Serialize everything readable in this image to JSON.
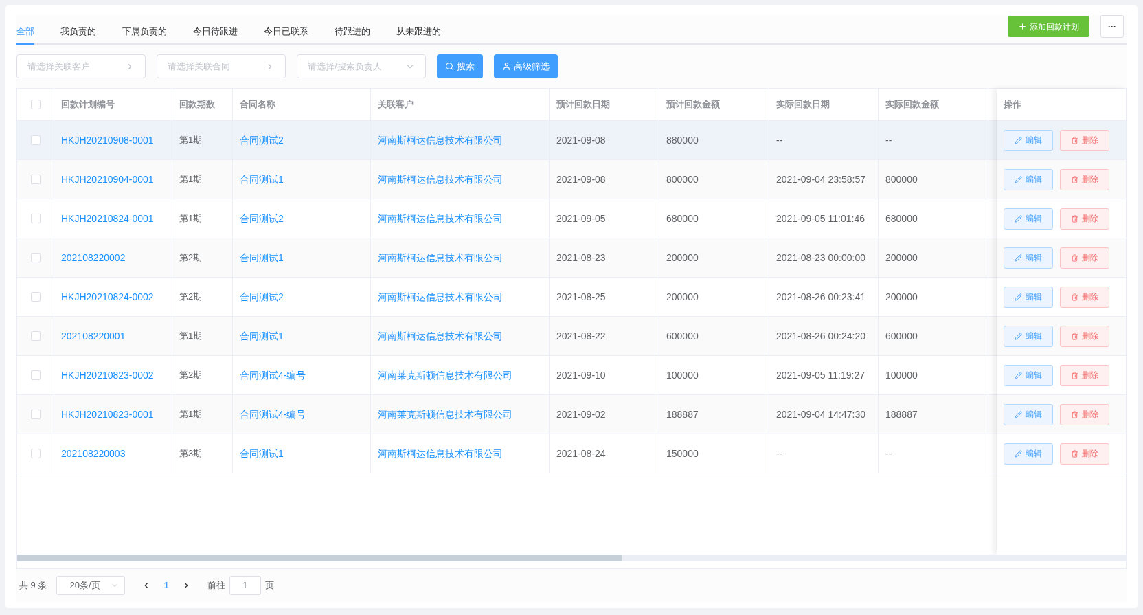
{
  "tabs": [
    {
      "label": "全部",
      "selected": true
    },
    {
      "label": "我负责的",
      "selected": false
    },
    {
      "label": "下属负责的",
      "selected": false
    },
    {
      "label": "今日待跟进",
      "selected": false
    },
    {
      "label": "今日已联系",
      "selected": false
    },
    {
      "label": "待跟进的",
      "selected": false
    },
    {
      "label": "从未跟进的",
      "selected": false
    }
  ],
  "add_button": "添加回款计划",
  "more_button": "···",
  "filters": [
    {
      "kind": "picker",
      "placeholder": "请选择关联客户"
    },
    {
      "kind": "picker",
      "placeholder": "请选择关联合同"
    },
    {
      "kind": "select",
      "placeholder": "请选择/搜索负责人"
    }
  ],
  "search_button": "搜索",
  "advanced_button": "高级筛选",
  "table": {
    "select_all_checked": false,
    "columns": [
      "回款计划编号",
      "回款期数",
      "合同名称",
      "关联客户",
      "预计回款日期",
      "预计回款金额",
      "实际回款日期",
      "实际回款金额"
    ],
    "action_column": "操作",
    "rows": [
      {
        "checked": false,
        "highlighted": true,
        "cells": [
          "HKJH20210908-0001",
          "第1期",
          "合同测试2",
          "河南斯柯达信息技术有限公司",
          "2021-09-08",
          "880000",
          "--",
          "--"
        ],
        "edit": "编辑",
        "delete": "删除"
      },
      {
        "checked": false,
        "highlighted": false,
        "cells": [
          "HKJH20210904-0001",
          "第1期",
          "合同测试1",
          "河南斯柯达信息技术有限公司",
          "2021-09-08",
          "800000",
          "2021-09-04 23:58:57",
          "800000"
        ],
        "edit": "编辑",
        "delete": "删除"
      },
      {
        "checked": false,
        "highlighted": false,
        "cells": [
          "HKJH20210824-0001",
          "第1期",
          "合同测试2",
          "河南斯柯达信息技术有限公司",
          "2021-09-05",
          "680000",
          "2021-09-05 11:01:46",
          "680000"
        ],
        "edit": "编辑",
        "delete": "删除"
      },
      {
        "checked": false,
        "highlighted": false,
        "cells": [
          "202108220002",
          "第2期",
          "合同测试1",
          "河南斯柯达信息技术有限公司",
          "2021-08-23",
          "200000",
          "2021-08-23 00:00:00",
          "200000"
        ],
        "edit": "编辑",
        "delete": "删除"
      },
      {
        "checked": false,
        "highlighted": false,
        "cells": [
          "HKJH20210824-0002",
          "第2期",
          "合同测试2",
          "河南斯柯达信息技术有限公司",
          "2021-08-25",
          "200000",
          "2021-08-26 00:23:41",
          "200000"
        ],
        "edit": "编辑",
        "delete": "删除"
      },
      {
        "checked": false,
        "highlighted": false,
        "cells": [
          "202108220001",
          "第1期",
          "合同测试1",
          "河南斯柯达信息技术有限公司",
          "2021-08-22",
          "600000",
          "2021-08-26 00:24:20",
          "600000"
        ],
        "edit": "编辑",
        "delete": "删除"
      },
      {
        "checked": false,
        "highlighted": false,
        "cells": [
          "HKJH20210823-0002",
          "第2期",
          "合同测试4-编号",
          "河南莱克斯顿信息技术有限公司",
          "2021-09-10",
          "100000",
          "2021-09-05 11:19:27",
          "100000"
        ],
        "edit": "编辑",
        "delete": "删除"
      },
      {
        "checked": false,
        "highlighted": false,
        "cells": [
          "HKJH20210823-0001",
          "第1期",
          "合同测试4-编号",
          "河南莱克斯顿信息技术有限公司",
          "2021-09-02",
          "188887",
          "2021-09-04 14:47:30",
          "188887"
        ],
        "edit": "编辑",
        "delete": "删除"
      },
      {
        "checked": false,
        "highlighted": false,
        "cells": [
          "202108220003",
          "第3期",
          "合同测试1",
          "河南斯柯达信息技术有限公司",
          "2021-08-24",
          "150000",
          "--",
          "--"
        ],
        "edit": "编辑",
        "delete": "删除"
      }
    ]
  },
  "pagination": {
    "total": "共 9 条",
    "page_size": "20条/页",
    "pages": [
      {
        "label": "1",
        "selected": true
      }
    ],
    "goto_label": "前往",
    "goto_value": "1",
    "page_suffix": "页"
  }
}
